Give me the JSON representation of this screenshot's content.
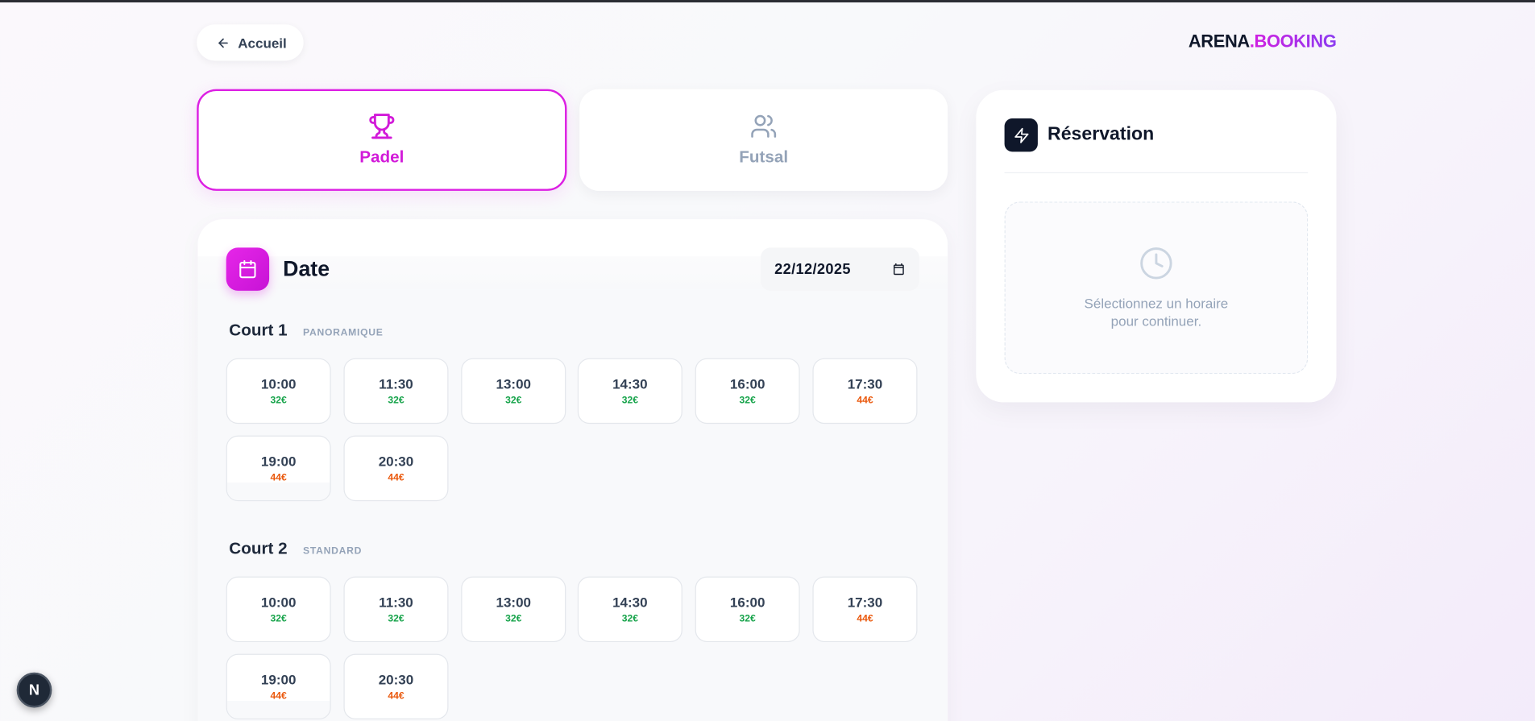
{
  "nav": {
    "back_label": "Accueil"
  },
  "brand": {
    "part1": "ARENA",
    "part2": ".BOOKING"
  },
  "sports": [
    {
      "label": "Padel",
      "icon": "trophy-icon",
      "active": true
    },
    {
      "label": "Futsal",
      "icon": "users-icon",
      "active": false
    }
  ],
  "date_section": {
    "title": "Date",
    "value": "22/12/2025"
  },
  "courts": [
    {
      "name": "Court 1",
      "tag": "PANORAMIQUE",
      "slots": [
        {
          "time": "10:00",
          "price": "32€"
        },
        {
          "time": "11:30",
          "price": "32€"
        },
        {
          "time": "13:00",
          "price": "32€"
        },
        {
          "time": "14:30",
          "price": "32€"
        },
        {
          "time": "16:00",
          "price": "32€"
        },
        {
          "time": "17:30",
          "price": "44€"
        },
        {
          "time": "19:00",
          "price": "44€"
        },
        {
          "time": "20:30",
          "price": "44€"
        }
      ]
    },
    {
      "name": "Court 2",
      "tag": "STANDARD",
      "slots": [
        {
          "time": "10:00",
          "price": "32€"
        },
        {
          "time": "11:30",
          "price": "32€"
        },
        {
          "time": "13:00",
          "price": "32€"
        },
        {
          "time": "14:30",
          "price": "32€"
        },
        {
          "time": "16:00",
          "price": "32€"
        },
        {
          "time": "17:30",
          "price": "44€"
        },
        {
          "time": "19:00",
          "price": "44€"
        },
        {
          "time": "20:30",
          "price": "44€"
        }
      ]
    }
  ],
  "reservation": {
    "title": "Réservation",
    "empty_message": "Sélectionnez un horaire pour continuer."
  },
  "dev_badge": {
    "label": "N"
  },
  "colors": {
    "accent": "#dc1fe3",
    "price_low": "#16a34a",
    "price_high": "#ea580c",
    "dark": "#0f172a"
  }
}
